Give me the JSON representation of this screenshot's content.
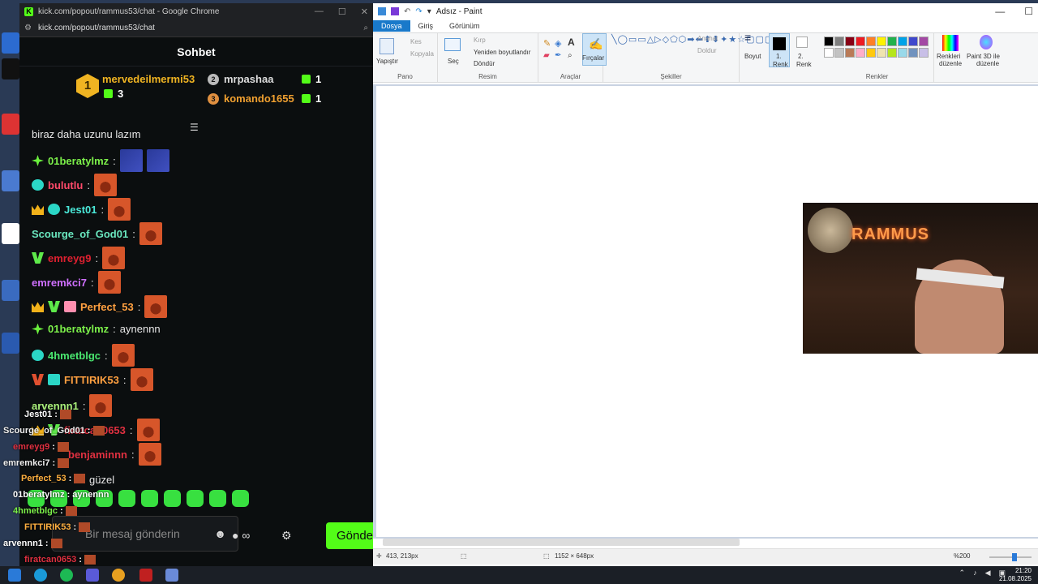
{
  "colors": {
    "kick_green": "#53fc18",
    "chat_bg": "#0b0e0f",
    "paint_accent": "#1979ca"
  },
  "chrome": {
    "title": "kick.com/popout/rammus53/chat - Google Chrome",
    "url": "kick.com/popout/rammus53/chat"
  },
  "chat": {
    "header": "Sohbet",
    "leaderboard": [
      {
        "rank": "1",
        "name": "mervedeilmermi53",
        "count": "3"
      },
      {
        "rank": "2",
        "name": "mrpashaa",
        "count": "1"
      },
      {
        "rank": "3",
        "name": "komando1655",
        "count": "1"
      }
    ],
    "partial_top_text": "biraz daha uzunu lazım",
    "messages": [
      {
        "user": "01beratylmz",
        "text": ""
      },
      {
        "user": "bulutlu",
        "text": ""
      },
      {
        "user": "Jest01",
        "text": ""
      },
      {
        "user": "Scourge_of_God01",
        "text": ""
      },
      {
        "user": "emreyg9",
        "text": ""
      },
      {
        "user": "emremkci7",
        "text": ""
      },
      {
        "user": "Perfect_53",
        "text": ""
      },
      {
        "user": "01beratylmz",
        "text": "aynennn"
      },
      {
        "user": "4hmetblgc",
        "text": ""
      },
      {
        "user": "FITTIRIK53",
        "text": ""
      },
      {
        "user": "arvennn1",
        "text": ""
      },
      {
        "user": "firatcan0653",
        "text": ""
      },
      {
        "user": "benjaminnn",
        "text": ""
      },
      {
        "user": "",
        "text": "güzel"
      }
    ],
    "input_placeholder": "Bir mesaj gönderin",
    "send_label": "Gönder"
  },
  "overlay": [
    {
      "user": "Jest01",
      "text": ""
    },
    {
      "user": "Scourge_of_God01",
      "text": ""
    },
    {
      "user": "emreyg9",
      "text": ""
    },
    {
      "user": "emremkci7",
      "text": ""
    },
    {
      "user": "Perfect_53",
      "text": ""
    },
    {
      "user": "01beratylmz",
      "text": "aynennn"
    },
    {
      "user": "4hmetblgc",
      "text": ""
    },
    {
      "user": "FITTIRIK53",
      "text": ""
    },
    {
      "user": "arvennn1",
      "text": ""
    },
    {
      "user": "firatcan0653",
      "text": ""
    }
  ],
  "paint": {
    "title": "Adsız - Paint",
    "tabs": [
      "Dosya",
      "Giriş",
      "Görünüm"
    ],
    "groups": {
      "pano": "Pano",
      "resim": "Resim",
      "araclar": "Araçlar",
      "sekiller": "Şekiller",
      "renkler": "Renkler"
    },
    "labels": {
      "yapistir": "Yapıştır",
      "kes": "Kes",
      "kopyala": "Kopyala",
      "sec": "Seç",
      "kirp": "Kırp",
      "yeniden_boyutlandir": "Yeniden boyutlandır",
      "dondur": "Döndür",
      "fircalar": "Fırçalar",
      "anahat": "Anahat",
      "doldur": "Doldur",
      "boyut": "Boyut",
      "renk1_a": "1.",
      "renk1_b": "Renk",
      "renk2_a": "2.",
      "renk2_b": "Renk",
      "renkleri_a": "Renkleri",
      "renkleri_b": "düzenle",
      "paint3d_a": "Paint 3D ile",
      "paint3d_b": "düzenle"
    },
    "status": {
      "cursor": "413, 213px",
      "size": "1152 × 648px",
      "zoom": "%200"
    },
    "palette": [
      "#000000",
      "#7f7f7f",
      "#880015",
      "#ed1c24",
      "#ff7f27",
      "#fff200",
      "#22b14c",
      "#00a2e8",
      "#3f48cc",
      "#a349a4",
      "#ffffff",
      "#c3c3c3",
      "#b97a57",
      "#ffaec9",
      "#ffc90e",
      "#efe4b0",
      "#b5e61d",
      "#99d9ea",
      "#7092be",
      "#c8bfe7"
    ]
  },
  "webcam": {
    "sign": "RAMMUS"
  },
  "taskbar": {
    "time": "21:20",
    "date": "21.08.2025"
  }
}
